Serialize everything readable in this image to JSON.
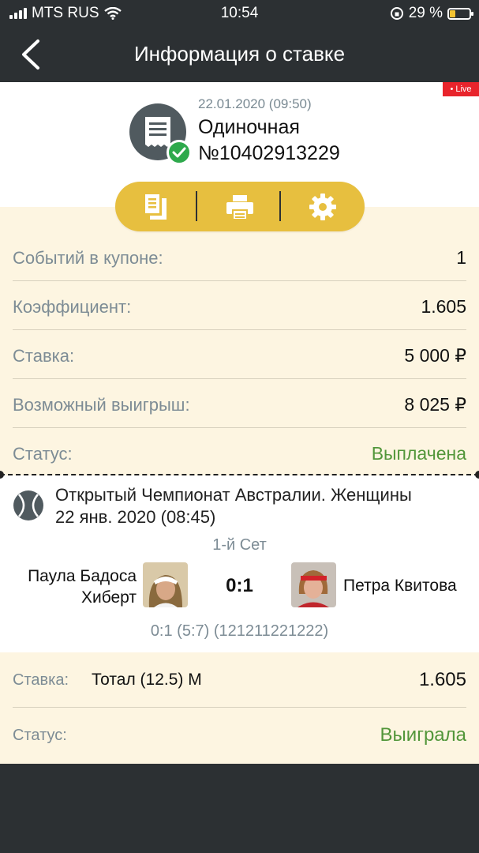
{
  "status_bar": {
    "carrier": "MTS RUS",
    "time": "10:54",
    "battery": "29 %",
    "battery_level": 0.29
  },
  "nav": {
    "title": "Информация о ставке"
  },
  "header": {
    "live_badge": "• Live",
    "date": "22.01.2020 (09:50)",
    "bet_type": "Одиночная",
    "bet_number": "№10402913229"
  },
  "details": [
    {
      "label": "Событий в купоне:",
      "value": "1"
    },
    {
      "label": "Коэффициент:",
      "value": "1.605"
    },
    {
      "label": "Ставка:",
      "value": "5 000 ₽"
    },
    {
      "label": "Возможный выигрыш:",
      "value": "8 025 ₽"
    },
    {
      "label": "Статус:",
      "value": "Выплачена"
    }
  ],
  "event": {
    "title": "Открытый Чемпионат Австралии. Женщины",
    "date": "22 янв. 2020 (08:45)",
    "set": "1-й Сет",
    "player1_line1": "Паула Бадоса",
    "player1_line2": "Хиберт",
    "score": "0:1",
    "player2": "Петра Квитова",
    "score_detail": "0:1 (5:7) (121211221222)"
  },
  "bet": {
    "stake_label": "Ставка:",
    "market": "Тотал (12.5) М",
    "odds": "1.605",
    "status_label": "Статус:",
    "status_value": "Выиграла"
  },
  "colors": {
    "accent": "#e7bf3f",
    "win_green": "#52963a",
    "live_red": "#e8242c",
    "dark_bg": "#2c3033",
    "panel": "#fdf5e1"
  }
}
